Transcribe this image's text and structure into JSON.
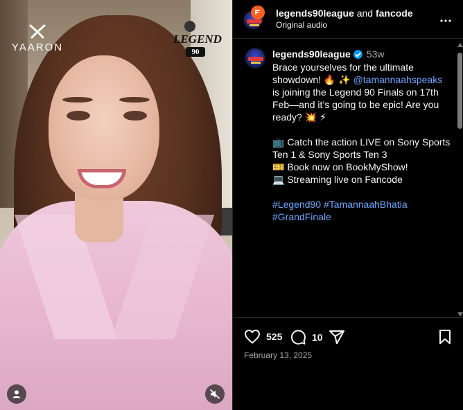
{
  "media": {
    "brand_logo": "YAARON",
    "event_logo": {
      "text": "LEGEND",
      "number": "90"
    },
    "profile_icon": "person-icon",
    "mute_icon": "speaker-muted-icon"
  },
  "header": {
    "account": "legends90league",
    "joiner": "and",
    "collaborator": "fancode",
    "subtitle": "Original audio",
    "more_icon": "more-horizontal-icon"
  },
  "caption": {
    "username": "legends90league",
    "verified": true,
    "age": "53w",
    "line1_a": "Brace yourselves for the ultimate showdown! 🔥 ✨ ",
    "mention": "@tamannaahspeaks",
    "line1_b": " is joining the Legend 90 Finals on 17th Feb—and it’s going to be epic! Are you ready? 💥 ⚡",
    "line2": "📺 Catch the action LIVE on Sony Sports Ten 1 & Sony Sports Ten 3",
    "line3": "🎫 Book now on BookMyShow!",
    "line4": "💻 Streaming live on Fancode",
    "hashtags": [
      "#Legend90",
      "#TamannaahBhatia",
      "#GrandFinale"
    ]
  },
  "actions": {
    "likes": "525",
    "comments": "10",
    "date": "February 13, 2025"
  },
  "colors": {
    "background": "#000000",
    "text": "#f5f5f5",
    "muted": "#a8a8a8",
    "link": "#6aa7ff",
    "verified": "#0095f6",
    "divider": "#262626"
  }
}
